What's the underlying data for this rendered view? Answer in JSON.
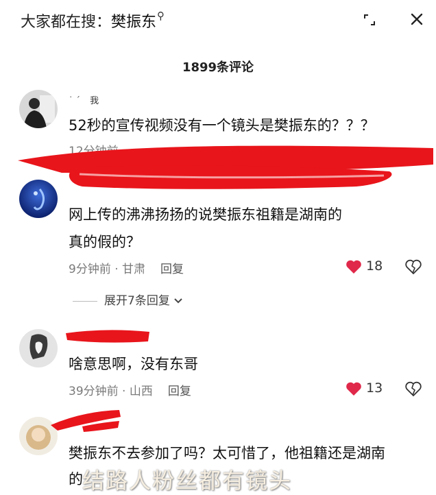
{
  "header": {
    "prefix": "大家都在搜：",
    "keyword": "樊振东",
    "search_glyph": "⚲",
    "icons": [
      "expand-icon",
      "close-icon"
    ]
  },
  "comment_count": "1899条评论",
  "comments": [
    {
      "user": "我",
      "text": "52秒的宣传视频没有一个镜头是樊振东的？？？",
      "time": "12分钟前"
    },
    {
      "text_lines": [
        "网上传的沸沸扬扬的说樊振东祖籍是湖南的",
        "真的假的？"
      ],
      "time": "9分钟前",
      "location": "甘肃",
      "reply_label": "回复",
      "likes": "18",
      "expand_label": "展开7条回复"
    },
    {
      "text": "啥意思啊，没有东哥",
      "time": "39分钟前",
      "location": "山西",
      "reply_label": "回复",
      "likes": "13"
    },
    {
      "text": "樊振东不去参加了吗？太可惜了，他祖籍还是湖南",
      "partial_text": "的"
    }
  ],
  "overlay_caption": "结路人粉丝都有镜头",
  "colors": {
    "like_heart": "#e0284a",
    "redaction": "#e8151b"
  }
}
